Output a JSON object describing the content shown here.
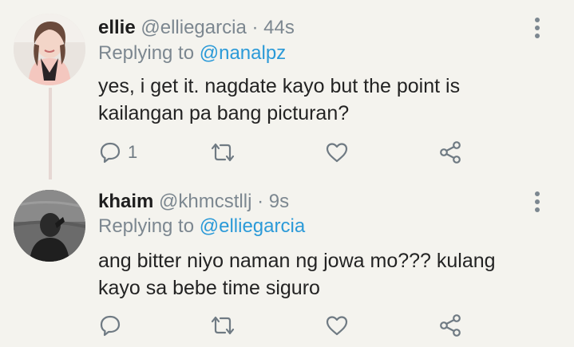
{
  "tweets": [
    {
      "name": "ellie",
      "handle": "@elliegarcia",
      "separator": "·",
      "time": "44s",
      "replying_prefix": "Replying to",
      "replying_to": "@nanalpz",
      "text": "yes, i get it. nagdate kayo but the point is kailangan pa bang picturan?",
      "reply_count": "1",
      "icons": [
        "reply-icon",
        "retweet-icon",
        "like-icon",
        "share-icon",
        "more-icon"
      ]
    },
    {
      "name": "khaim",
      "handle": "@khmcstllj",
      "separator": "·",
      "time": "9s",
      "replying_prefix": "Replying to",
      "replying_to": "@elliegarcia",
      "text": "ang bitter niyo naman ng jowa mo??? kulang kayo sa bebe time siguro",
      "reply_count": "",
      "icons": [
        "reply-icon",
        "retweet-icon",
        "like-icon",
        "share-icon",
        "more-icon"
      ]
    }
  ],
  "colors": {
    "background": "#f4f3ee",
    "mention": "#2b9ad8",
    "muted": "#7c8790",
    "thread_line": "#e6d7d3"
  }
}
